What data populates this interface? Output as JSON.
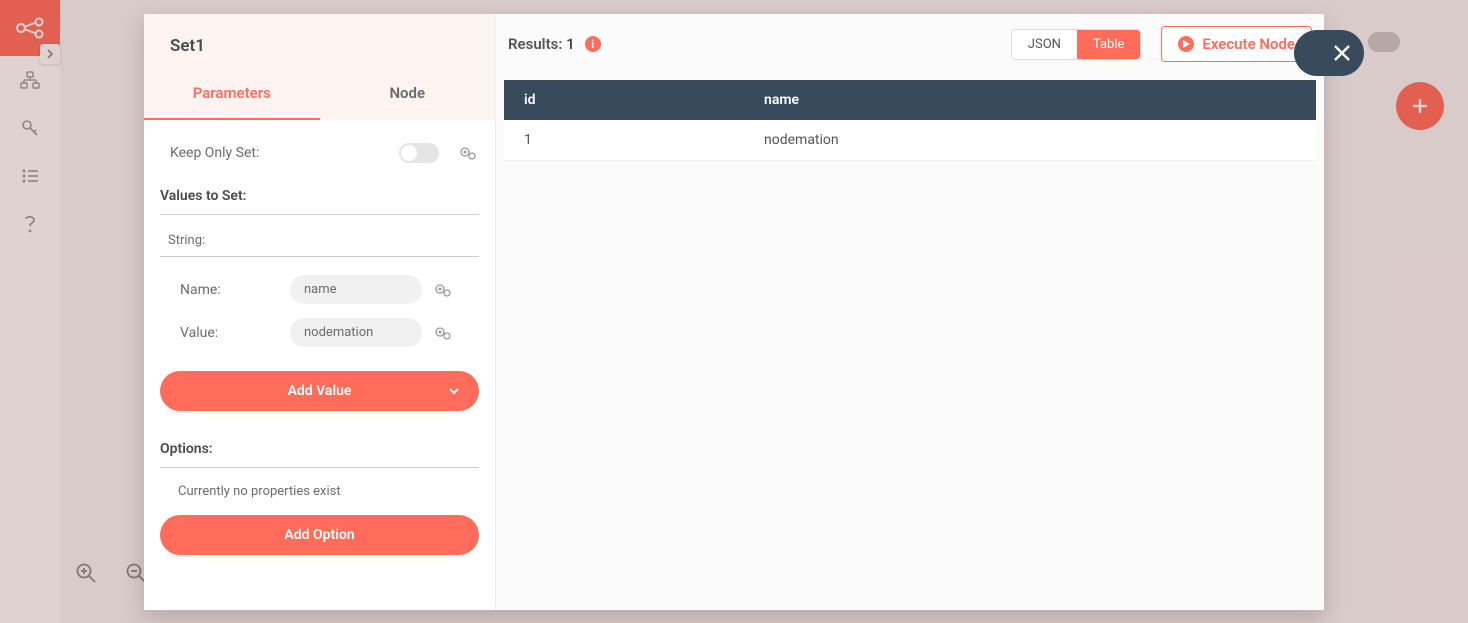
{
  "sidebar": {
    "logo_alt": "workflow-logo"
  },
  "node": {
    "title": "Set1",
    "tabs": {
      "parameters": "Parameters",
      "node": "Node"
    },
    "keep_only_set_label": "Keep Only Set:",
    "values_header": "Values to Set:",
    "string_label": "String:",
    "name_label": "Name:",
    "value_label": "Value:",
    "name_value": "name",
    "value_value": "nodemation",
    "add_value_label": "Add Value",
    "options_header": "Options:",
    "options_empty": "Currently no properties exist",
    "add_option_label": "Add Option"
  },
  "results": {
    "label": "Results:",
    "count": "1",
    "view_json": "JSON",
    "view_table": "Table",
    "execute_label": "Execute Node",
    "columns": [
      "id",
      "name"
    ],
    "rows": [
      {
        "id": "1",
        "name": "nodemation"
      }
    ]
  }
}
